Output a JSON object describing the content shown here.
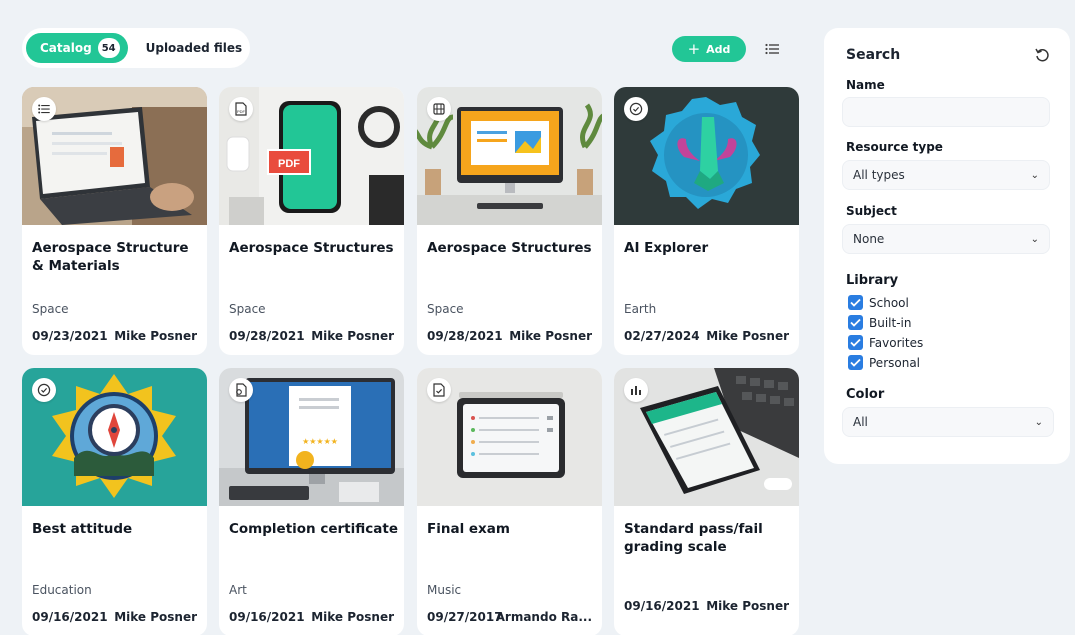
{
  "tabs": {
    "catalog_label": "Catalog",
    "catalog_count": "54",
    "uploaded_label": "Uploaded files"
  },
  "toolbar": {
    "add_label": "Add",
    "list_view_icon": "list-icon"
  },
  "cards": [
    {
      "title": "Aerospace Structure & Materials",
      "subject": "Space",
      "date": "09/23/2021",
      "author": "Mike Posner",
      "type_icon": "list-icon"
    },
    {
      "title": "Aerospace Structures",
      "subject": "Space",
      "date": "09/28/2021",
      "author": "Mike Posner",
      "type_icon": "pdf-icon"
    },
    {
      "title": "Aerospace Structures",
      "subject": "Space",
      "date": "09/28/2021",
      "author": "Mike Posner",
      "type_icon": "film-icon"
    },
    {
      "title": "AI Explorer",
      "subject": "Earth",
      "date": "02/27/2024",
      "author": "Mike Posner",
      "type_icon": "badge-check-icon"
    },
    {
      "title": "Best attitude",
      "subject": "Education",
      "date": "09/16/2021",
      "author": "Mike Posner",
      "type_icon": "badge-check-icon"
    },
    {
      "title": "Completion certificate",
      "subject": "Art",
      "date": "09/16/2021",
      "author": "Mike Posner",
      "type_icon": "certificate-icon"
    },
    {
      "title": "Final exam",
      "subject": "Music",
      "date": "09/27/2017",
      "author": "Armando Ra...",
      "type_icon": "exam-icon"
    },
    {
      "title": "Standard pass/fail grading scale",
      "subject": "",
      "date": "09/16/2021",
      "author": "Mike Posner",
      "type_icon": "bar-chart-icon"
    }
  ],
  "filters": {
    "title": "Search",
    "reset_icon": "reset-icon",
    "name_label": "Name",
    "name_value": "",
    "resource_type_label": "Resource type",
    "resource_type_value": "All types",
    "subject_label": "Subject",
    "subject_value": "None",
    "library_label": "Library",
    "library_options": [
      {
        "label": "School",
        "checked": true
      },
      {
        "label": "Built-in",
        "checked": true
      },
      {
        "label": "Favorites",
        "checked": true
      },
      {
        "label": "Personal",
        "checked": true
      }
    ],
    "color_label": "Color",
    "color_value": "All"
  },
  "colors": {
    "accent": "#22c696",
    "checkbox": "#2a7de1",
    "background": "#eef2f6"
  }
}
